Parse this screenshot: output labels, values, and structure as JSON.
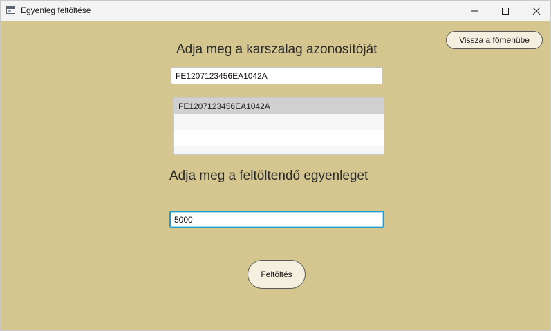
{
  "window": {
    "title": "Egyenleg feltöltése",
    "icon": "app-window-icon",
    "controls": {
      "minimize_icon": "minimize-icon",
      "maximize_icon": "maximize-icon",
      "close_icon": "close-icon"
    }
  },
  "back_button": {
    "label": "Vissza a főmenübe"
  },
  "card_section": {
    "heading": "Adja meg a karszalag azonosítóját",
    "input_value": "FE1207123456EA1042A",
    "list_items": [
      "FE1207123456EA1042A"
    ],
    "selected_item": "FE1207123456EA1042A"
  },
  "amount_section": {
    "heading": "Adja meg a feltöltendő egyenleget",
    "input_value": "5000"
  },
  "submit_button": {
    "label": "Feltöltés"
  },
  "colors": {
    "background": "#d4c68e",
    "button_fill": "#f4efdf",
    "focus_border": "#1f9bd1",
    "selected_row": "#d0d0d0"
  }
}
